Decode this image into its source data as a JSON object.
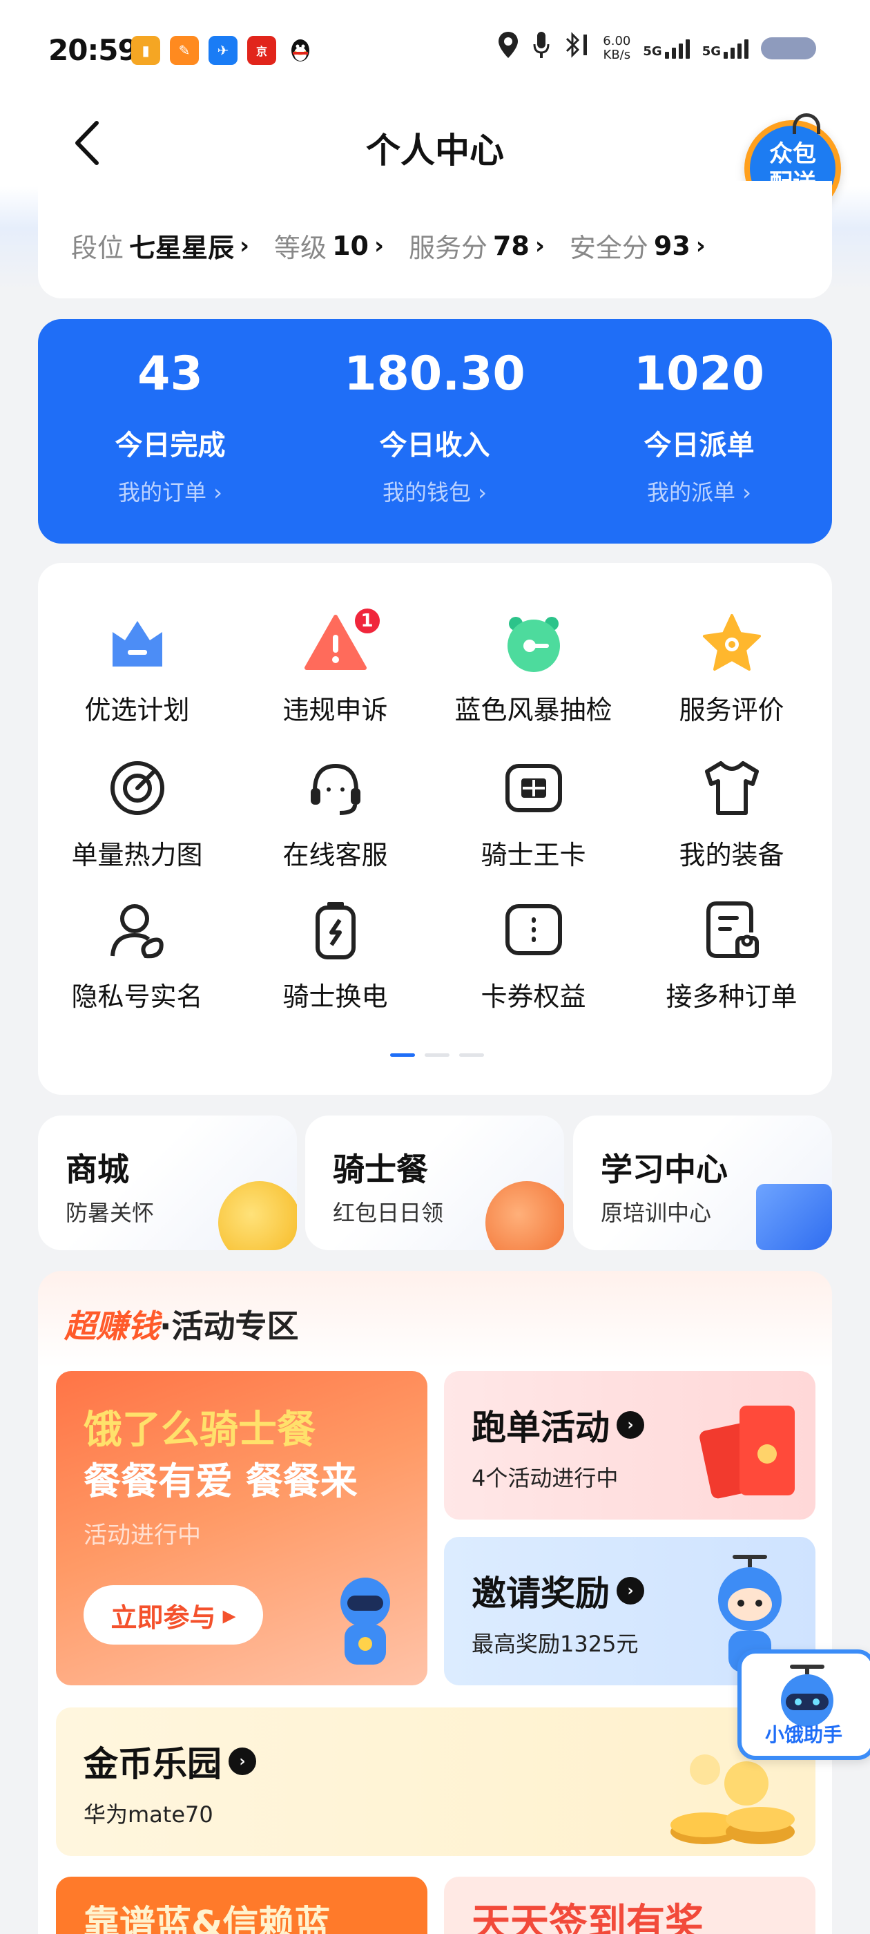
{
  "status_bar": {
    "time": "20:59",
    "app_icons": [
      {
        "name": "wallet-app-icon",
        "color": "#f5a623",
        "glyph": "▮"
      },
      {
        "name": "ride-app-icon",
        "color": "#ff8a1f",
        "glyph": "✎"
      },
      {
        "name": "flight-app-icon",
        "color": "#1a7cf5",
        "glyph": "✈"
      },
      {
        "name": "jd-express-app-icon",
        "color": "#e1251b",
        "glyph": "京"
      },
      {
        "name": "qq-app-icon",
        "color": "#111111",
        "glyph": "🐧"
      }
    ],
    "network_speed": "6.00",
    "network_unit": "KB/s",
    "sim1": "5G",
    "sim2": "5G"
  },
  "header": {
    "title": "个人中心",
    "crowd_badge_line1": "众包",
    "crowd_badge_line2": "配送"
  },
  "rank": {
    "items": [
      {
        "label": "段位",
        "value": "七星星辰"
      },
      {
        "label": "等级",
        "value": "10"
      },
      {
        "label": "服务分",
        "value": "78"
      },
      {
        "label": "安全分",
        "value": "93"
      }
    ]
  },
  "stats": [
    {
      "value": "43",
      "label": "今日完成",
      "link": "我的订单 ›"
    },
    {
      "value": "180.30",
      "label": "今日收入",
      "link": "我的钱包 ›"
    },
    {
      "value": "1020",
      "label": "今日派单",
      "link": "我的派单 ›"
    }
  ],
  "services": [
    {
      "label": "优选计划",
      "icon": "crown-icon"
    },
    {
      "label": "违规申诉",
      "icon": "warning-icon",
      "badge": "1"
    },
    {
      "label": "蓝色风暴抽检",
      "icon": "alarm-clock-icon"
    },
    {
      "label": "服务评价",
      "icon": "star-icon"
    },
    {
      "label": "单量热力图",
      "icon": "target-icon"
    },
    {
      "label": "在线客服",
      "icon": "headset-icon"
    },
    {
      "label": "骑士王卡",
      "icon": "sim-card-icon"
    },
    {
      "label": "我的装备",
      "icon": "tshirt-icon"
    },
    {
      "label": "隐私号实名",
      "icon": "user-privacy-icon"
    },
    {
      "label": "骑士换电",
      "icon": "battery-swap-icon"
    },
    {
      "label": "卡券权益",
      "icon": "coupon-icon"
    },
    {
      "label": "接多种订单",
      "icon": "order-doc-icon"
    }
  ],
  "tiles": [
    {
      "title": "商城",
      "sub": "防暑关怀"
    },
    {
      "title": "骑士餐",
      "sub": "红包日日领"
    },
    {
      "title": "学习中心",
      "sub": "原培训中心"
    }
  ],
  "activity": {
    "title_hot": "超赚钱",
    "title_rest": "·活动专区",
    "big_promo": {
      "line1": "饿了么骑士餐",
      "line2": "餐餐有爱 餐餐来",
      "status": "活动进行中",
      "button": "立即参与"
    },
    "run_promo": {
      "title": "跑单活动",
      "sub": "4个活动进行中"
    },
    "invite_promo": {
      "title": "邀请奖励",
      "sub": "最高奖励1325元"
    },
    "coin_promo": {
      "title": "金币乐园",
      "sub": "华为mate70"
    },
    "bottom_left": "靠谱蓝&信赖蓝",
    "bottom_right": "天天签到有奖"
  },
  "assistant": {
    "label": "小饿助手"
  },
  "colors": {
    "primary": "#1f6ef7",
    "accent_orange": "#ff5a2a",
    "badge_red": "#f0263b"
  }
}
